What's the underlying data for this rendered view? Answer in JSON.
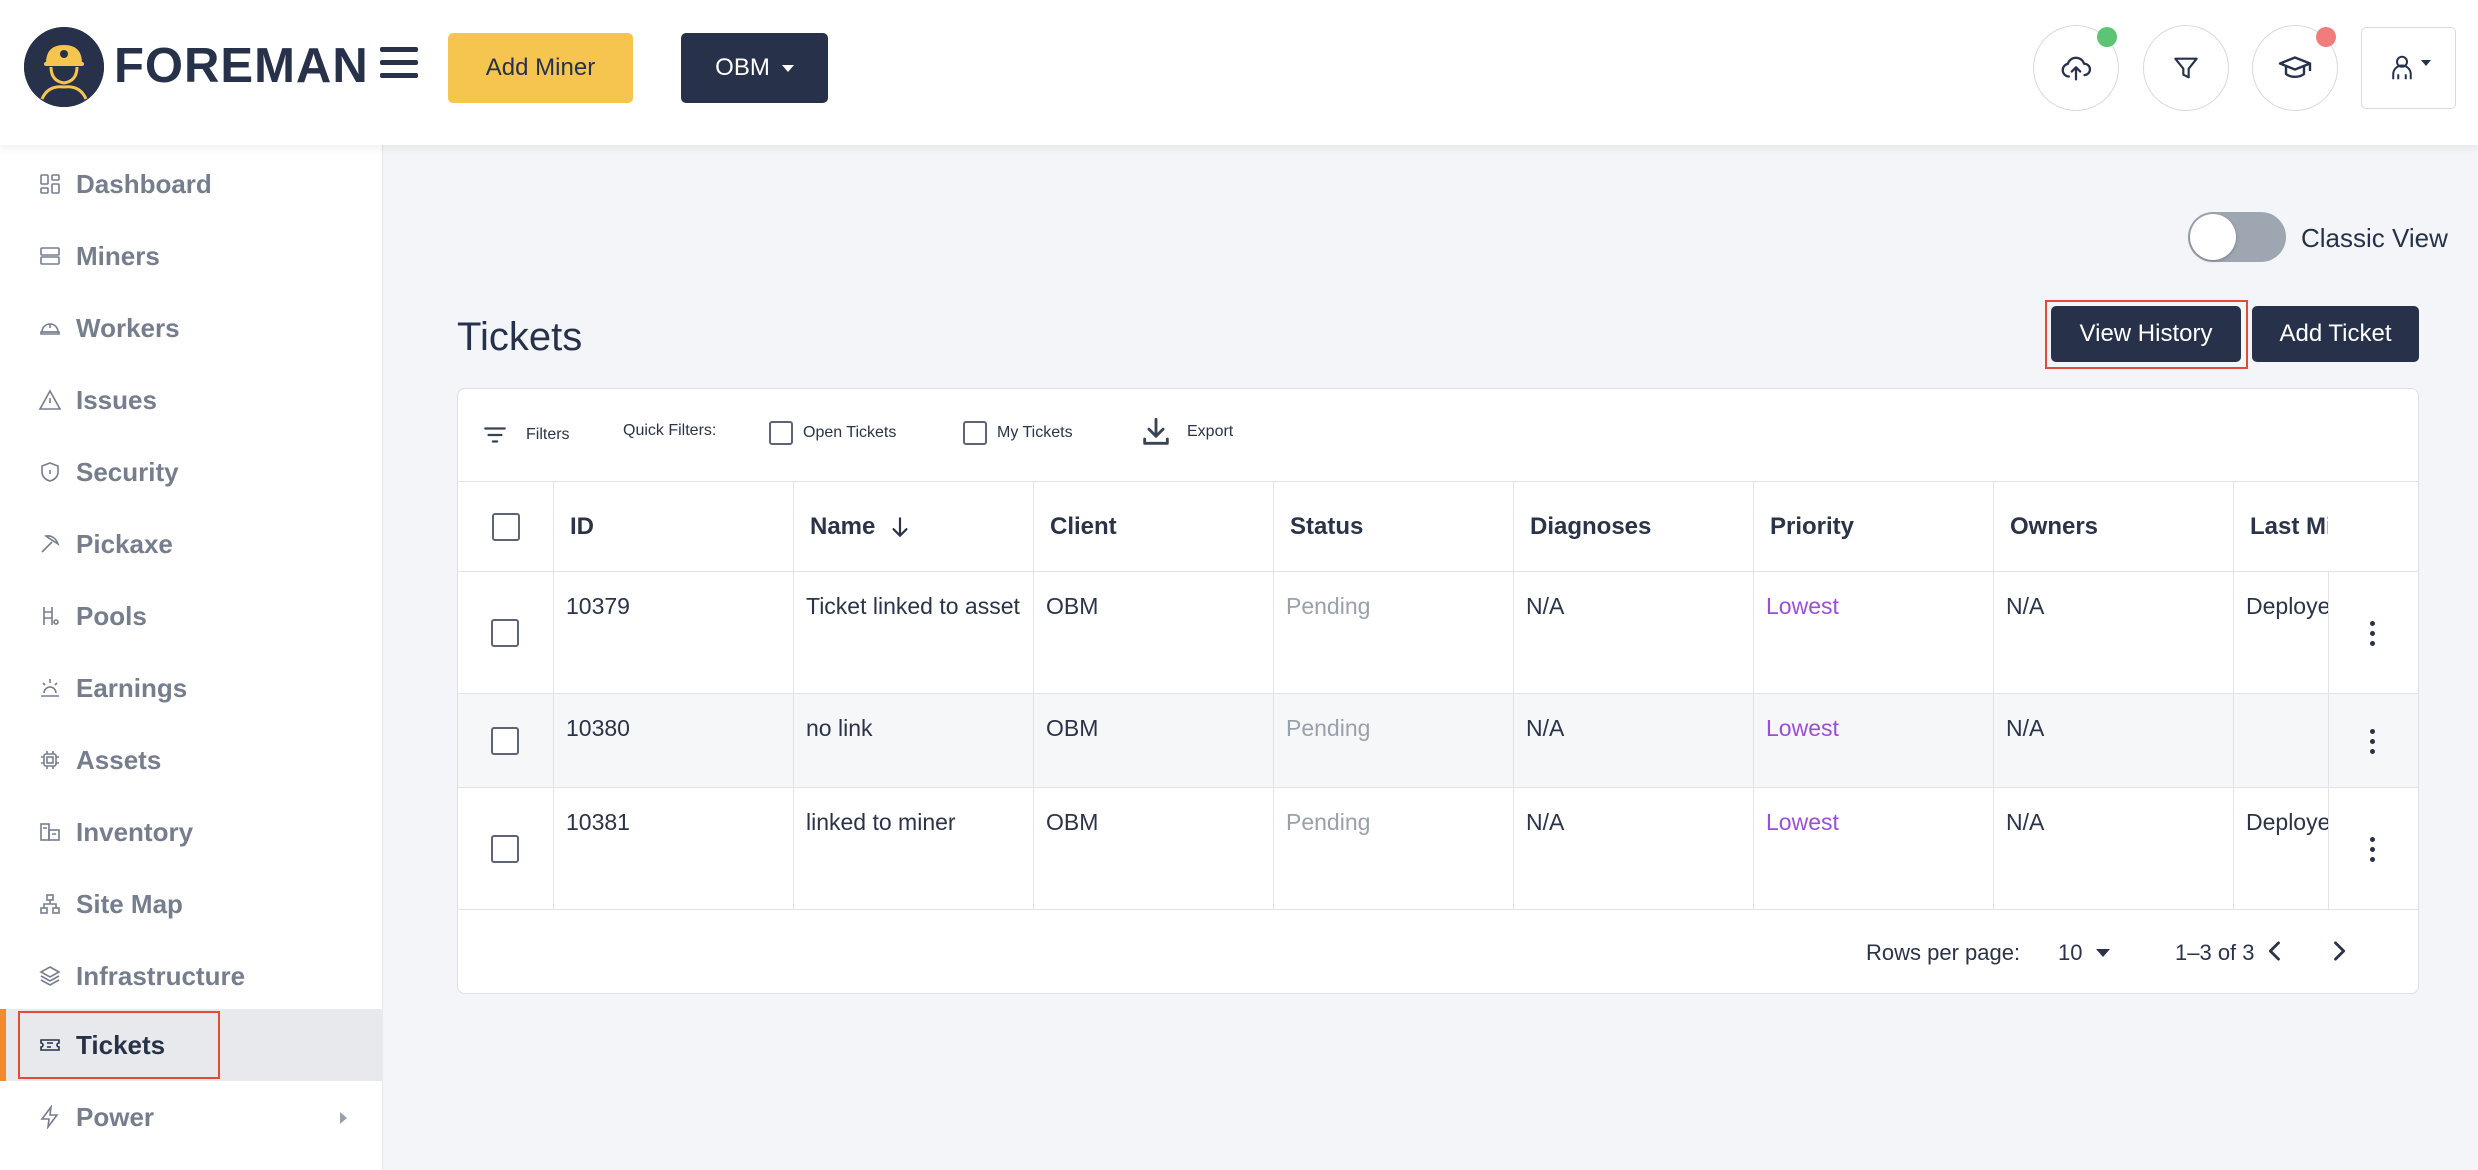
{
  "header": {
    "brand": "FOREMAN",
    "add_miner_label": "Add Miner",
    "client_select": "OBM",
    "status_colors": {
      "upload_dot": "#5cc473",
      "training_dot": "#f07c7c"
    }
  },
  "sidebar": {
    "items": [
      {
        "label": "Dashboard",
        "icon": "dashboard-icon"
      },
      {
        "label": "Miners",
        "icon": "server-icon"
      },
      {
        "label": "Workers",
        "icon": "hardhat-icon"
      },
      {
        "label": "Issues",
        "icon": "warning-icon"
      },
      {
        "label": "Security",
        "icon": "shield-icon"
      },
      {
        "label": "Pickaxe",
        "icon": "pickaxe-icon"
      },
      {
        "label": "Pools",
        "icon": "pools-icon"
      },
      {
        "label": "Earnings",
        "icon": "earnings-icon"
      },
      {
        "label": "Assets",
        "icon": "chip-icon"
      },
      {
        "label": "Inventory",
        "icon": "inventory-icon"
      },
      {
        "label": "Site Map",
        "icon": "sitemap-icon"
      },
      {
        "label": "Infrastructure",
        "icon": "layers-icon"
      },
      {
        "label": "Tickets",
        "icon": "ticket-icon"
      },
      {
        "label": "Power",
        "icon": "bolt-icon"
      }
    ],
    "active": "Tickets"
  },
  "main": {
    "classic_view_label": "Classic View",
    "title": "Tickets",
    "view_history_label": "View History",
    "add_ticket_label": "Add Ticket",
    "toolbar": {
      "filters_label": "Filters",
      "quick_filters_label": "Quick Filters:",
      "open_tickets_label": "Open Tickets",
      "my_tickets_label": "My Tickets",
      "export_label": "Export"
    },
    "table": {
      "columns": [
        "ID",
        "Name",
        "Client",
        "Status",
        "Diagnoses",
        "Priority",
        "Owners",
        "Last Mi"
      ],
      "rows": [
        {
          "id": "10379",
          "name": "Ticket linked to asset",
          "client": "OBM",
          "status": "Pending",
          "diagnoses": "N/A",
          "priority": "Lowest",
          "owners": "N/A",
          "last": "Deploye"
        },
        {
          "id": "10380",
          "name": "no link",
          "client": "OBM",
          "status": "Pending",
          "diagnoses": "N/A",
          "priority": "Lowest",
          "owners": "N/A",
          "last": ""
        },
        {
          "id": "10381",
          "name": "linked to miner",
          "client": "OBM",
          "status": "Pending",
          "diagnoses": "N/A",
          "priority": "Lowest",
          "owners": "N/A",
          "last": "Deploye"
        }
      ]
    },
    "pagination": {
      "rows_per_page_label": "Rows per page:",
      "rows_per_page": "10",
      "range": "1–3 of 3"
    }
  }
}
